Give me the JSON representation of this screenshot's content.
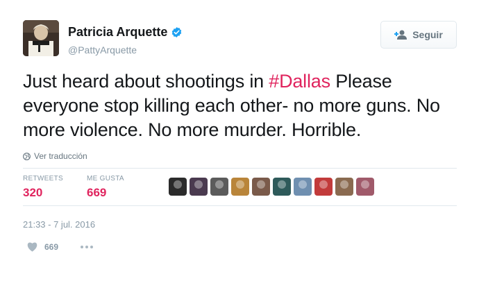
{
  "author": {
    "display_name": "Patricia Arquette",
    "handle": "@PattyArquette",
    "verified_icon": "verified-badge-icon",
    "avatar_icon": "profile-photo"
  },
  "follow_button": {
    "label": "Seguir",
    "icon": "add-user-icon"
  },
  "tweet": {
    "text_before": "Just heard about shootings in ",
    "hashtag": "#Dallas",
    "text_after": " Please everyone stop killing each other- no more guns. No more violence. No more murder. Horrible."
  },
  "translate": {
    "label": "Ver traducción",
    "icon": "globe-icon"
  },
  "stats": {
    "retweets_label": "RETWEETS",
    "retweets_value": "320",
    "likes_label": "ME GUSTA",
    "likes_value": "669"
  },
  "likers": [
    {
      "color": "#2b2b2b"
    },
    {
      "color": "#4a3a4f"
    },
    {
      "color": "#5b5b5b"
    },
    {
      "color": "#b9853a"
    },
    {
      "color": "#7a5a4a"
    },
    {
      "color": "#2e5a5a"
    },
    {
      "color": "#6f8fb0"
    },
    {
      "color": "#c23b3b"
    },
    {
      "color": "#8a6a50"
    },
    {
      "color": "#a05a6a"
    }
  ],
  "timestamp": "21:33 - 7 jul. 2016",
  "actions": {
    "like_icon": "heart-icon",
    "like_count": "669",
    "more_icon": "more-icon"
  },
  "colors": {
    "accent": "#e0245e",
    "verified_blue": "#1da1f2",
    "muted_text": "#8899a6"
  }
}
